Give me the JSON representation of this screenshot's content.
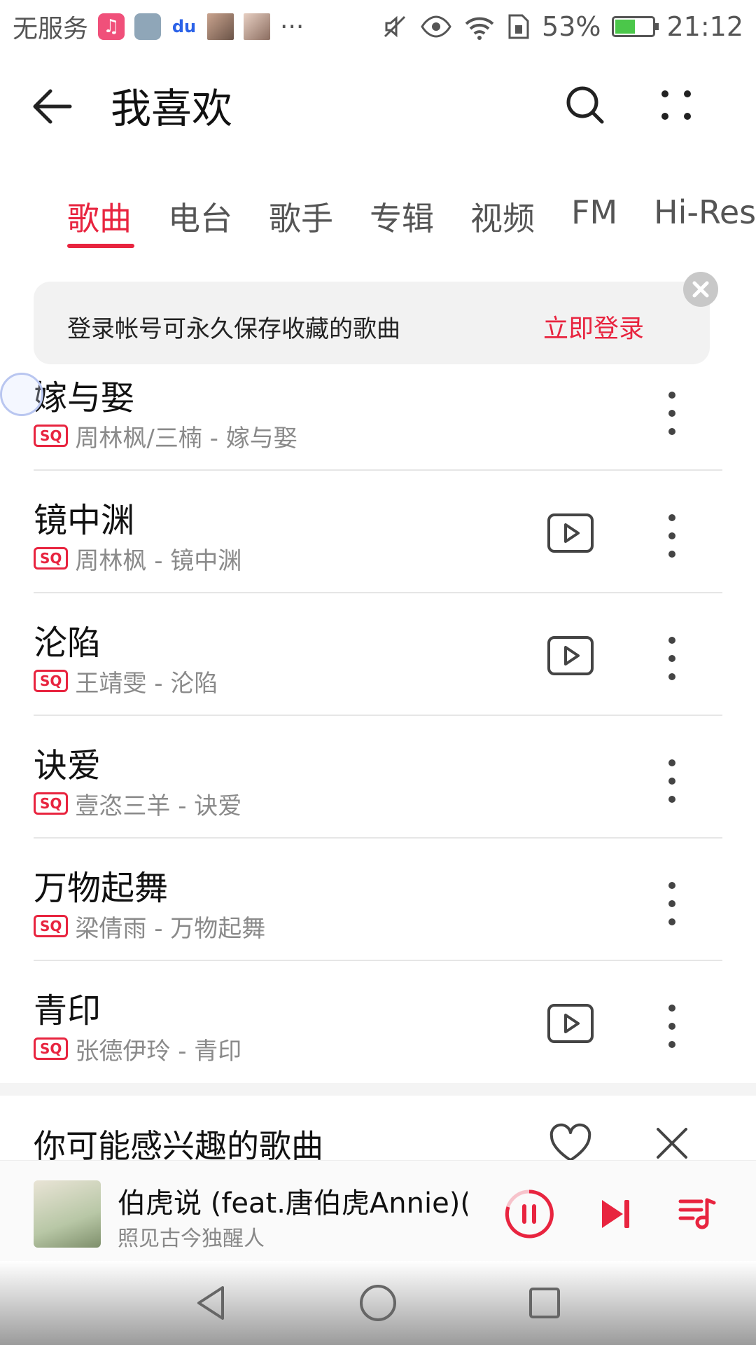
{
  "status_bar": {
    "carrier": "无服务",
    "overflow": "···",
    "battery_percent": "53%",
    "time": "21:12",
    "battery_level": 0.53
  },
  "header": {
    "title": "我喜欢"
  },
  "tabs": [
    {
      "label": "歌曲",
      "active": true
    },
    {
      "label": "电台",
      "active": false
    },
    {
      "label": "歌手",
      "active": false
    },
    {
      "label": "专辑",
      "active": false
    },
    {
      "label": "视频",
      "active": false
    },
    {
      "label": "FM",
      "active": false
    },
    {
      "label": "Hi-Res",
      "active": false
    }
  ],
  "login_banner": {
    "text": "登录帐号可永久保存收藏的歌曲",
    "link": "立即登录"
  },
  "quality_badge": "SQ",
  "songs": [
    {
      "title": "嫁与娶",
      "subtitle": "周林枫/三楠 - 嫁与娶",
      "has_mv": false
    },
    {
      "title": "镜中渊",
      "subtitle": "周林枫 - 镜中渊",
      "has_mv": true
    },
    {
      "title": "沦陷",
      "subtitle": "王靖雯 - 沦陷",
      "has_mv": true
    },
    {
      "title": "诀爱",
      "subtitle": "壹恣三羊 - 诀爱",
      "has_mv": false
    },
    {
      "title": "万物起舞",
      "subtitle": "梁倩雨 - 万物起舞",
      "has_mv": false
    },
    {
      "title": "青印",
      "subtitle": "张德伊玲 - 青印",
      "has_mv": true
    }
  ],
  "recommendation": {
    "title": "你可能感兴趣的歌曲"
  },
  "player": {
    "title": "伯虎说 (feat.唐伯虎Annie)(...",
    "artist": "照见古今独醒人"
  },
  "colors": {
    "accent": "#e8243f",
    "text_secondary": "#8a8a8a"
  }
}
